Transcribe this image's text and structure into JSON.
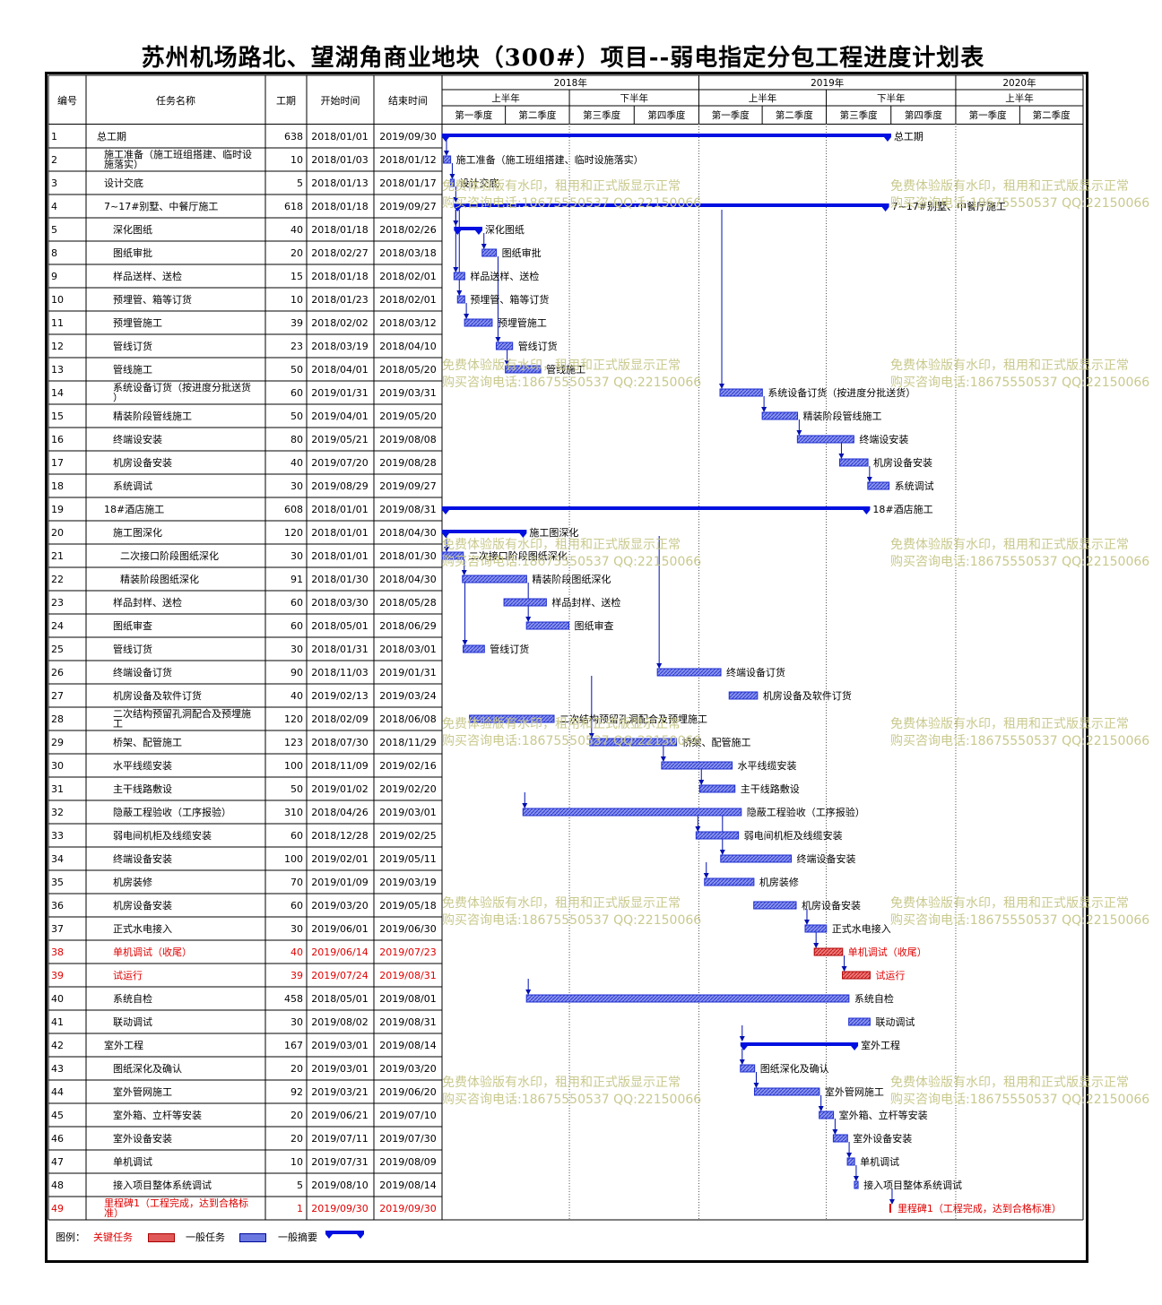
{
  "title": "苏州机场路北、望湖角商业地块（300#）项目--弱电指定分包工程进度计划表",
  "headers": {
    "id": "编号",
    "name": "任务名称",
    "duration": "工期",
    "start": "开始时间",
    "end": "结束时间"
  },
  "timeline": {
    "years": [
      {
        "label": "2018年",
        "from": "2018-01-01",
        "to": "2019-01-01"
      },
      {
        "label": "2019年",
        "from": "2019-01-01",
        "to": "2020-01-01"
      },
      {
        "label": "2020年",
        "from": "2020-01-01",
        "to": "2020-06-30"
      }
    ],
    "halves": [
      {
        "label": "上半年",
        "from": "2018-01-01",
        "to": "2018-07-01"
      },
      {
        "label": "下半年",
        "from": "2018-07-01",
        "to": "2019-01-01"
      },
      {
        "label": "上半年",
        "from": "2019-01-01",
        "to": "2019-07-01"
      },
      {
        "label": "下半年",
        "from": "2019-07-01",
        "to": "2020-01-01"
      },
      {
        "label": "上半年",
        "from": "2020-01-01",
        "to": "2020-06-30"
      }
    ],
    "quarters": [
      {
        "label": "第一季度",
        "from": "2018-01-01",
        "to": "2018-04-01"
      },
      {
        "label": "第二季度",
        "from": "2018-04-01",
        "to": "2018-07-01"
      },
      {
        "label": "第三季度",
        "from": "2018-07-01",
        "to": "2018-10-01"
      },
      {
        "label": "第四季度",
        "from": "2018-10-01",
        "to": "2019-01-01"
      },
      {
        "label": "第一季度",
        "from": "2019-01-01",
        "to": "2019-04-01"
      },
      {
        "label": "第二季度",
        "from": "2019-04-01",
        "to": "2019-07-01"
      },
      {
        "label": "第三季度",
        "from": "2019-07-01",
        "to": "2019-10-01"
      },
      {
        "label": "第四季度",
        "from": "2019-10-01",
        "to": "2020-01-01"
      },
      {
        "label": "第一季度",
        "from": "2020-01-01",
        "to": "2020-04-01"
      },
      {
        "label": "第二季度",
        "from": "2020-04-01",
        "to": "2020-06-30"
      }
    ]
  },
  "chart_data": {
    "type": "gantt",
    "x_range": [
      "2018-01-01",
      "2020-06-30"
    ],
    "tasks": [
      {
        "id": "1",
        "name": "总工期",
        "duration": "638",
        "start": "2018/01/01",
        "end": "2019/09/30",
        "kind": "summary",
        "level": 0,
        "critical": false
      },
      {
        "id": "2",
        "name": "施工准备（施工班组搭建、临时设施落实）",
        "duration": "10",
        "start": "2018/01/03",
        "end": "2018/01/12",
        "kind": "task",
        "level": 1,
        "critical": false
      },
      {
        "id": "3",
        "name": "设计交底",
        "duration": "5",
        "start": "2018/01/13",
        "end": "2018/01/17",
        "kind": "task",
        "level": 1,
        "critical": false
      },
      {
        "id": "4",
        "name": "7~17#别墅、中餐厅施工",
        "duration": "618",
        "start": "2018/01/18",
        "end": "2019/09/27",
        "kind": "summary",
        "level": 1,
        "critical": false
      },
      {
        "id": "5",
        "name": "深化图纸",
        "duration": "40",
        "start": "2018/01/18",
        "end": "2018/02/26",
        "kind": "summary",
        "level": 2,
        "critical": false
      },
      {
        "id": "8",
        "name": "图纸审批",
        "duration": "20",
        "start": "2018/02/27",
        "end": "2018/03/18",
        "kind": "task",
        "level": 2,
        "critical": false
      },
      {
        "id": "9",
        "name": "样品送样、送检",
        "duration": "15",
        "start": "2018/01/18",
        "end": "2018/02/01",
        "kind": "task",
        "level": 2,
        "critical": false
      },
      {
        "id": "10",
        "name": "预埋管、箱等订货",
        "duration": "10",
        "start": "2018/01/23",
        "end": "2018/02/01",
        "kind": "task",
        "level": 2,
        "critical": false
      },
      {
        "id": "11",
        "name": "预埋管施工",
        "duration": "39",
        "start": "2018/02/02",
        "end": "2018/03/12",
        "kind": "task",
        "level": 2,
        "critical": false
      },
      {
        "id": "12",
        "name": "管线订货",
        "duration": "23",
        "start": "2018/03/19",
        "end": "2018/04/10",
        "kind": "task",
        "level": 2,
        "critical": false
      },
      {
        "id": "13",
        "name": "管线施工",
        "duration": "50",
        "start": "2018/04/01",
        "end": "2018/05/20",
        "kind": "task",
        "level": 2,
        "critical": false
      },
      {
        "id": "14",
        "name": "系统设备订货（按进度分批送货）",
        "duration": "60",
        "start": "2019/01/31",
        "end": "2019/03/31",
        "kind": "task",
        "level": 2,
        "critical": false
      },
      {
        "id": "15",
        "name": "精装阶段管线施工",
        "duration": "50",
        "start": "2019/04/01",
        "end": "2019/05/20",
        "kind": "task",
        "level": 2,
        "critical": false
      },
      {
        "id": "16",
        "name": "终端设安装",
        "duration": "80",
        "start": "2019/05/21",
        "end": "2019/08/08",
        "kind": "task",
        "level": 2,
        "critical": false
      },
      {
        "id": "17",
        "name": "机房设备安装",
        "duration": "40",
        "start": "2019/07/20",
        "end": "2019/08/28",
        "kind": "task",
        "level": 2,
        "critical": false
      },
      {
        "id": "18",
        "name": "系统调试",
        "duration": "30",
        "start": "2019/08/29",
        "end": "2019/09/27",
        "kind": "task",
        "level": 2,
        "critical": false
      },
      {
        "id": "19",
        "name": "18#酒店施工",
        "duration": "608",
        "start": "2018/01/01",
        "end": "2019/08/31",
        "kind": "summary",
        "level": 1,
        "critical": false
      },
      {
        "id": "20",
        "name": "施工图深化",
        "duration": "120",
        "start": "2018/01/01",
        "end": "2018/04/30",
        "kind": "summary",
        "level": 2,
        "critical": false
      },
      {
        "id": "21",
        "name": "二次接口阶段图纸深化",
        "duration": "30",
        "start": "2018/01/01",
        "end": "2018/01/30",
        "kind": "task",
        "level": 3,
        "critical": false
      },
      {
        "id": "22",
        "name": "精装阶段图纸深化",
        "duration": "91",
        "start": "2018/01/30",
        "end": "2018/04/30",
        "kind": "task",
        "level": 3,
        "critical": false
      },
      {
        "id": "23",
        "name": "样品封样、送检",
        "duration": "60",
        "start": "2018/03/30",
        "end": "2018/05/28",
        "kind": "task",
        "level": 2,
        "critical": false
      },
      {
        "id": "24",
        "name": "图纸审查",
        "duration": "60",
        "start": "2018/05/01",
        "end": "2018/06/29",
        "kind": "task",
        "level": 2,
        "critical": false
      },
      {
        "id": "25",
        "name": "管线订货",
        "duration": "30",
        "start": "2018/01/31",
        "end": "2018/03/01",
        "kind": "task",
        "level": 2,
        "critical": false
      },
      {
        "id": "26",
        "name": "终端设备订货",
        "duration": "90",
        "start": "2018/11/03",
        "end": "2019/01/31",
        "kind": "task",
        "level": 2,
        "critical": false
      },
      {
        "id": "27",
        "name": "机房设备及软件订货",
        "duration": "40",
        "start": "2019/02/13",
        "end": "2019/03/24",
        "kind": "task",
        "level": 2,
        "critical": false
      },
      {
        "id": "28",
        "name": "二次结构预留孔洞配合及预埋施工",
        "duration": "120",
        "start": "2018/02/09",
        "end": "2018/06/08",
        "kind": "task",
        "level": 2,
        "critical": false
      },
      {
        "id": "29",
        "name": "桥架、配管施工",
        "duration": "123",
        "start": "2018/07/30",
        "end": "2018/11/29",
        "kind": "task",
        "level": 2,
        "critical": false
      },
      {
        "id": "30",
        "name": "水平线缆安装",
        "duration": "100",
        "start": "2018/11/09",
        "end": "2019/02/16",
        "kind": "task",
        "level": 2,
        "critical": false
      },
      {
        "id": "31",
        "name": "主干线路敷设",
        "duration": "50",
        "start": "2019/01/02",
        "end": "2019/02/20",
        "kind": "task",
        "level": 2,
        "critical": false
      },
      {
        "id": "32",
        "name": "隐蔽工程验收（工序报验）",
        "duration": "310",
        "start": "2018/04/26",
        "end": "2019/03/01",
        "kind": "task",
        "level": 2,
        "critical": false
      },
      {
        "id": "33",
        "name": "弱电间机柜及线缆安装",
        "duration": "60",
        "start": "2018/12/28",
        "end": "2019/02/25",
        "kind": "task",
        "level": 2,
        "critical": false
      },
      {
        "id": "34",
        "name": "终端设备安装",
        "duration": "100",
        "start": "2019/02/01",
        "end": "2019/05/11",
        "kind": "task",
        "level": 2,
        "critical": false
      },
      {
        "id": "35",
        "name": "机房装修",
        "duration": "70",
        "start": "2019/01/09",
        "end": "2019/03/19",
        "kind": "task",
        "level": 2,
        "critical": false
      },
      {
        "id": "36",
        "name": "机房设备安装",
        "duration": "60",
        "start": "2019/03/20",
        "end": "2019/05/18",
        "kind": "task",
        "level": 2,
        "critical": false
      },
      {
        "id": "37",
        "name": "正式水电接入",
        "duration": "30",
        "start": "2019/06/01",
        "end": "2019/06/30",
        "kind": "task",
        "level": 2,
        "critical": false
      },
      {
        "id": "38",
        "name": "单机调试（收尾）",
        "duration": "40",
        "start": "2019/06/14",
        "end": "2019/07/23",
        "kind": "task",
        "level": 2,
        "critical": true
      },
      {
        "id": "39",
        "name": "试运行",
        "duration": "39",
        "start": "2019/07/24",
        "end": "2019/08/31",
        "kind": "task",
        "level": 2,
        "critical": true
      },
      {
        "id": "40",
        "name": "系统自检",
        "duration": "458",
        "start": "2018/05/01",
        "end": "2019/08/01",
        "kind": "task",
        "level": 2,
        "critical": false
      },
      {
        "id": "41",
        "name": "联动调试",
        "duration": "30",
        "start": "2019/08/02",
        "end": "2019/08/31",
        "kind": "task",
        "level": 2,
        "critical": false
      },
      {
        "id": "42",
        "name": "室外工程",
        "duration": "167",
        "start": "2019/03/01",
        "end": "2019/08/14",
        "kind": "summary",
        "level": 1,
        "critical": false
      },
      {
        "id": "43",
        "name": "图纸深化及确认",
        "duration": "20",
        "start": "2019/03/01",
        "end": "2019/03/20",
        "kind": "task",
        "level": 2,
        "critical": false
      },
      {
        "id": "44",
        "name": "室外管网施工",
        "duration": "92",
        "start": "2019/03/21",
        "end": "2019/06/20",
        "kind": "task",
        "level": 2,
        "critical": false
      },
      {
        "id": "45",
        "name": "室外箱、立杆等安装",
        "duration": "20",
        "start": "2019/06/21",
        "end": "2019/07/10",
        "kind": "task",
        "level": 2,
        "critical": false
      },
      {
        "id": "46",
        "name": "室外设备安装",
        "duration": "20",
        "start": "2019/07/11",
        "end": "2019/07/30",
        "kind": "task",
        "level": 2,
        "critical": false
      },
      {
        "id": "47",
        "name": "单机调试",
        "duration": "10",
        "start": "2019/07/31",
        "end": "2019/08/09",
        "kind": "task",
        "level": 2,
        "critical": false
      },
      {
        "id": "48",
        "name": "接入项目整体系统调试",
        "duration": "5",
        "start": "2019/08/10",
        "end": "2019/08/14",
        "kind": "task",
        "level": 2,
        "critical": false
      },
      {
        "id": "49",
        "name": "里程碑1（工程完成，达到合格标准）",
        "duration": "1",
        "start": "2019/09/30",
        "end": "2019/09/30",
        "kind": "milestone",
        "level": 1,
        "critical": true
      }
    ]
  },
  "watermark": {
    "line1": "免费体验版有水印，租用和正式版显示正常",
    "line2": "购买咨询电话:18675550537 QQ:22150066"
  },
  "legend": {
    "label": "图例：",
    "critical": "关键任务",
    "general": "一般任务",
    "summary": "一般摘要"
  },
  "colors": {
    "bar": "#1f2fd0",
    "bar_fill": "#6a78e0",
    "critical": "#e05858",
    "critical_text": "#e00000",
    "summary": "#0010e0",
    "arrow": "#0010b0",
    "watermark": "#c9c98e"
  }
}
